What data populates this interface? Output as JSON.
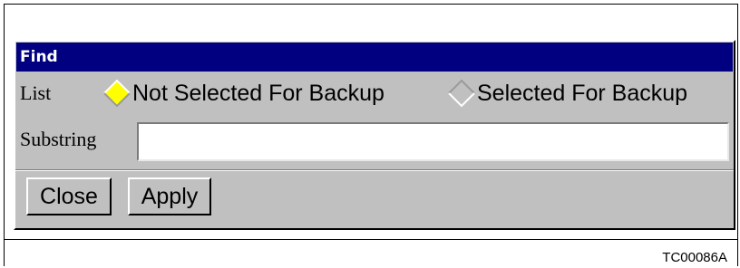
{
  "dialog": {
    "title": "Find",
    "list_label": "List",
    "list_options": [
      {
        "label": "Not Selected For Backup",
        "selected": true
      },
      {
        "label": "Selected For Backup",
        "selected": false
      }
    ],
    "substring_label": "Substring",
    "substring_value": "",
    "buttons": {
      "close_label": "Close",
      "apply_label": "Apply"
    }
  },
  "figure_id": "TC00086A",
  "colors": {
    "titlebar": "#000080",
    "dialog_bg": "#c0c0c0",
    "selected_radio": "#ffff00"
  },
  "icons": {
    "radio_selected": "diamond-radio-selected-icon",
    "radio_unselected": "diamond-radio-unselected-icon"
  }
}
